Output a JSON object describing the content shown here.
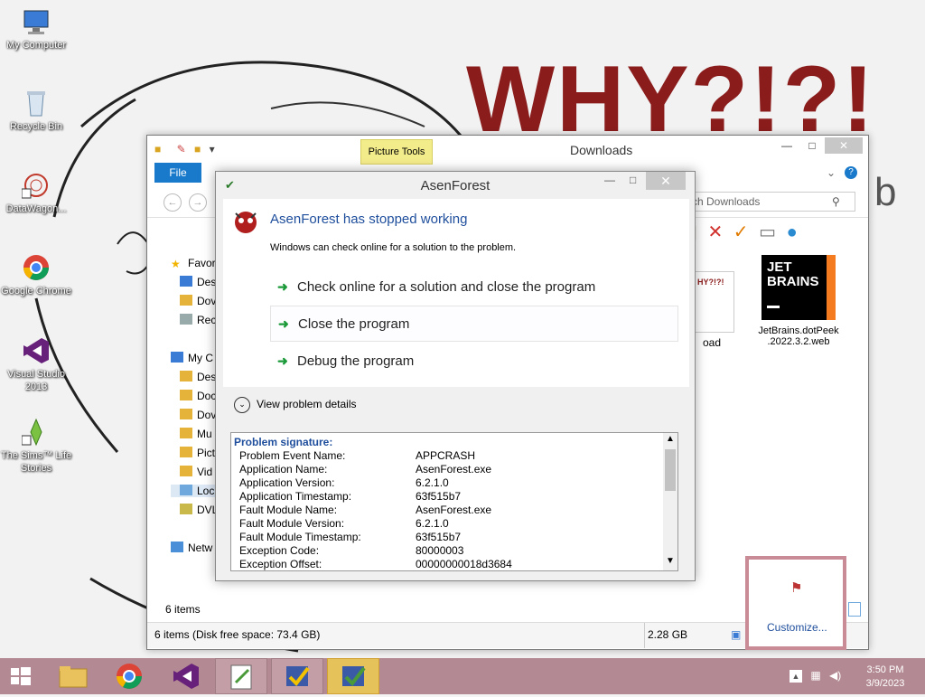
{
  "wallpaper": {
    "headline": "WHY?!?!",
    "tail_text": "b"
  },
  "desktop_icons": [
    {
      "label": "My Computer"
    },
    {
      "label": "Recycle Bin"
    },
    {
      "label": "DataWagon..."
    },
    {
      "label": "Google Chrome"
    },
    {
      "label": "Visual Studio 2013"
    },
    {
      "label": "The Sims™ Life Stories"
    }
  ],
  "explorer": {
    "title": "Downloads",
    "picture_tools": "Picture Tools",
    "file_tab": "File",
    "search_placeholder": "ch Downloads",
    "nav": {
      "favorites": "Favor",
      "desktop": "Des",
      "downloads": "Dov",
      "recent": "Rec",
      "computer": "My C",
      "c_desktop": "Des",
      "documents": "Doc",
      "c_downloads": "Dov",
      "music": "Mu",
      "pictures": "Pict",
      "videos": "Vid",
      "local_disk": "Loc",
      "dvd": "DVL",
      "network": "Netw"
    },
    "files": [
      {
        "label": "oad"
      },
      {
        "label": "JetBrains.dotPeek .2022.3.2.web",
        "logo_line1": "JET",
        "logo_line2": "BRAINS"
      }
    ],
    "item_count": "6 items",
    "status_left": "6 items (Disk free space: 73.4 GB)",
    "status_size": "2.28 GB"
  },
  "dialog": {
    "title": "AsenForest",
    "heading": "AsenForest has stopped working",
    "subtext": "Windows can check online for a solution to the problem.",
    "options": [
      "Check online for a solution and close the program",
      "Close the program",
      "Debug the program"
    ],
    "details_label": "View problem details",
    "signature_title": "Problem signature:",
    "signature": [
      {
        "k": "Problem Event Name:",
        "v": "APPCRASH"
      },
      {
        "k": "Application Name:",
        "v": "AsenForest.exe"
      },
      {
        "k": "Application Version:",
        "v": "6.2.1.0"
      },
      {
        "k": "Application Timestamp:",
        "v": "63f515b7"
      },
      {
        "k": "Fault Module Name:",
        "v": "AsenForest.exe"
      },
      {
        "k": "Fault Module Version:",
        "v": "6.2.1.0"
      },
      {
        "k": "Fault Module Timestamp:",
        "v": "63f515b7"
      },
      {
        "k": "Exception Code:",
        "v": "80000003"
      },
      {
        "k": "Exception Offset:",
        "v": "00000000018d3684"
      }
    ]
  },
  "notification": {
    "customize_label": "Customize..."
  },
  "taskbar": {
    "time": "3:50 PM",
    "date": "3/9/2023"
  },
  "colors": {
    "accent_blue": "#1e4e9c",
    "taskbar": "#b38a93",
    "file_tab": "#1979ca",
    "why_red": "#8b1c1c"
  }
}
